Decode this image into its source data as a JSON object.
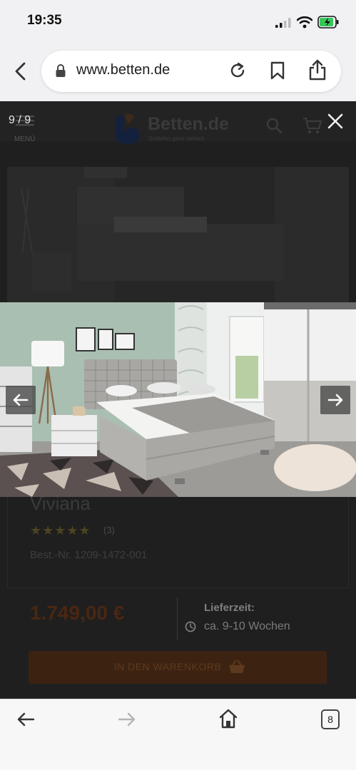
{
  "status_bar": {
    "time": "19:35"
  },
  "browser": {
    "url": "www.betten.de"
  },
  "page": {
    "menu_label": "MENÜ",
    "logo_text": "Betten.de",
    "logo_tagline": "Schlafen ganz einfach",
    "product": {
      "name": "Viviana",
      "stars": "★★★★★",
      "rating_count": "(3)",
      "sku": "Best.-Nr. 1209-1472-001",
      "price": "1.749,00 €",
      "delivery_label": "Lieferzeit:",
      "delivery_value": "ca. 9-10 Wochen",
      "cart_button": "IN DEN WARENKORB"
    }
  },
  "lightbox": {
    "counter": "9 / 9"
  },
  "toolbar": {
    "tab_count": "8"
  },
  "colors": {
    "accent_price": "#4a2712",
    "cart_button": "#3c2311",
    "overlay": "#1f1f1f"
  }
}
